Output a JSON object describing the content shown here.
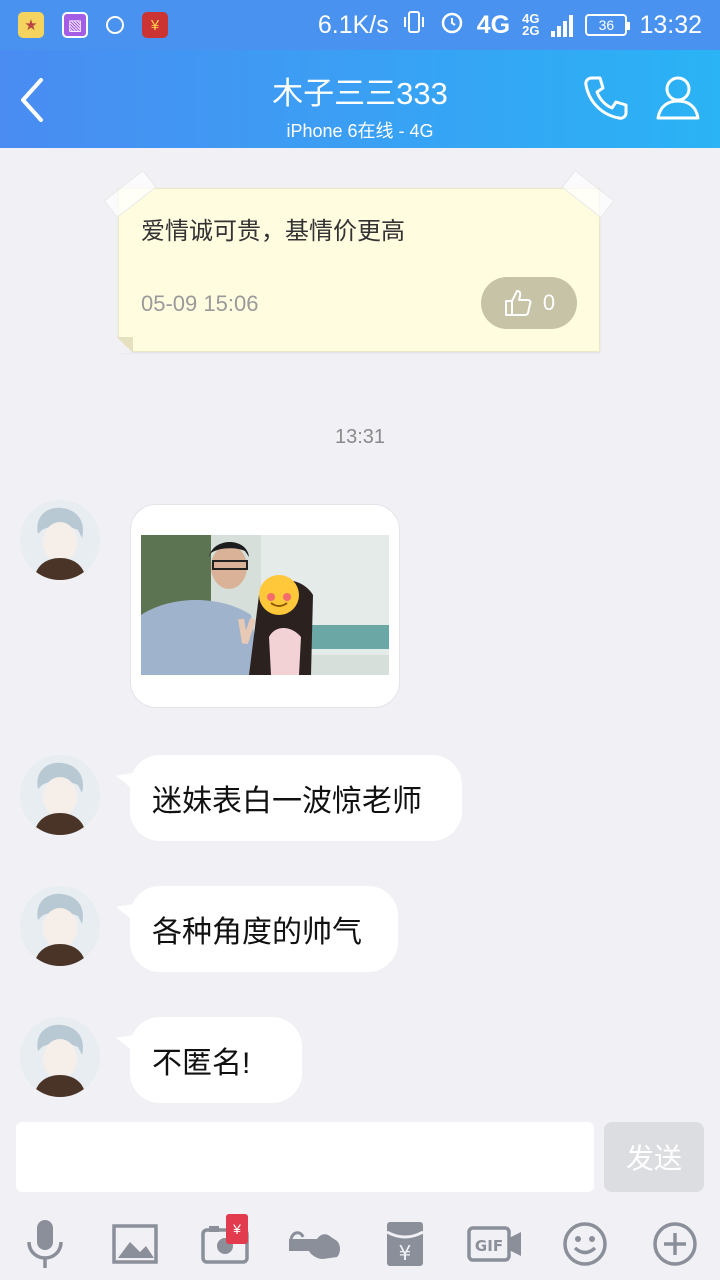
{
  "status_bar": {
    "net_speed": "6.1K/s",
    "network": "4G",
    "network_small_top": "4G",
    "network_small_bottom": "2G",
    "battery": "36",
    "time": "13:32",
    "icons": [
      "app-notification-icon",
      "gallery-icon",
      "chat-icon",
      "red-packet-icon",
      "vibrate-icon",
      "alarm-icon",
      "signal-icon",
      "battery-icon"
    ]
  },
  "header": {
    "title": "木子三三333",
    "subtitle": "iPhone 6在线 - 4G",
    "icons": [
      "back-arrow-icon",
      "phone-icon",
      "person-icon"
    ]
  },
  "note": {
    "text": "爱情诚可贵，基情价更高",
    "time": "05-09 15:06",
    "likes": "0"
  },
  "chat": {
    "time_label": "13:31",
    "messages": [
      {
        "type": "image"
      },
      {
        "type": "text",
        "text": "迷妹表白一波惊老师"
      },
      {
        "type": "text",
        "text": "各种角度的帅气"
      },
      {
        "type": "text",
        "text": "不匿名!"
      }
    ]
  },
  "input": {
    "placeholder": "",
    "send_label": "发送"
  },
  "toolbar": {
    "items": [
      "microphone-icon",
      "image-icon",
      "camera-icon",
      "poke-icon",
      "red-packet-icon",
      "gif-icon",
      "emoji-icon",
      "plus-icon"
    ],
    "gif_label": "GIF",
    "yuan": "¥"
  },
  "colors": {
    "header_start": "#4a8cf2",
    "header_end": "#2ab3f5",
    "background": "#f0f0f5",
    "note_bg": "#fffce0"
  }
}
